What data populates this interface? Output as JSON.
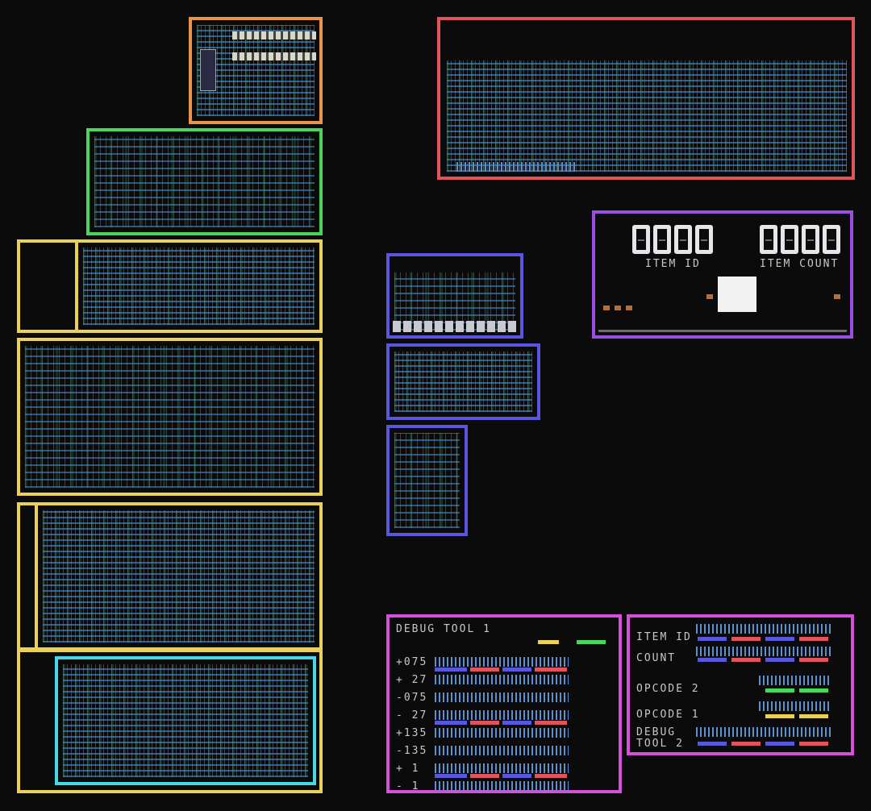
{
  "colors": {
    "background": "#0b0b0c",
    "orange": "#e8944a",
    "green": "#4bd65a",
    "yellow": "#ead15a",
    "cyan": "#46d8e6",
    "red": "#e2535a",
    "purple": "#9a4fe0",
    "blue": "#5a56de",
    "magenta": "#d64fd8"
  },
  "display": {
    "item_id_label": "ITEM ID",
    "item_count_label": "ITEM COUNT",
    "item_id_digits": [
      "0",
      "0",
      "0",
      "0"
    ],
    "item_count_digits": [
      "0",
      "0",
      "0",
      "0"
    ]
  },
  "debug_tool_1": {
    "title": "DEBUG TOOL 1",
    "rows": [
      "+075",
      "+ 27",
      "-075",
      "- 27",
      "+135",
      "-135",
      "+ 1",
      "- 1"
    ]
  },
  "debug_tool_2": {
    "item_id": "ITEM ID",
    "count": "COUNT",
    "opcode_2": "OPCODE 2",
    "opcode_1": "OPCODE 1",
    "title_line1": "DEBUG",
    "title_line2": "TOOL 2"
  }
}
